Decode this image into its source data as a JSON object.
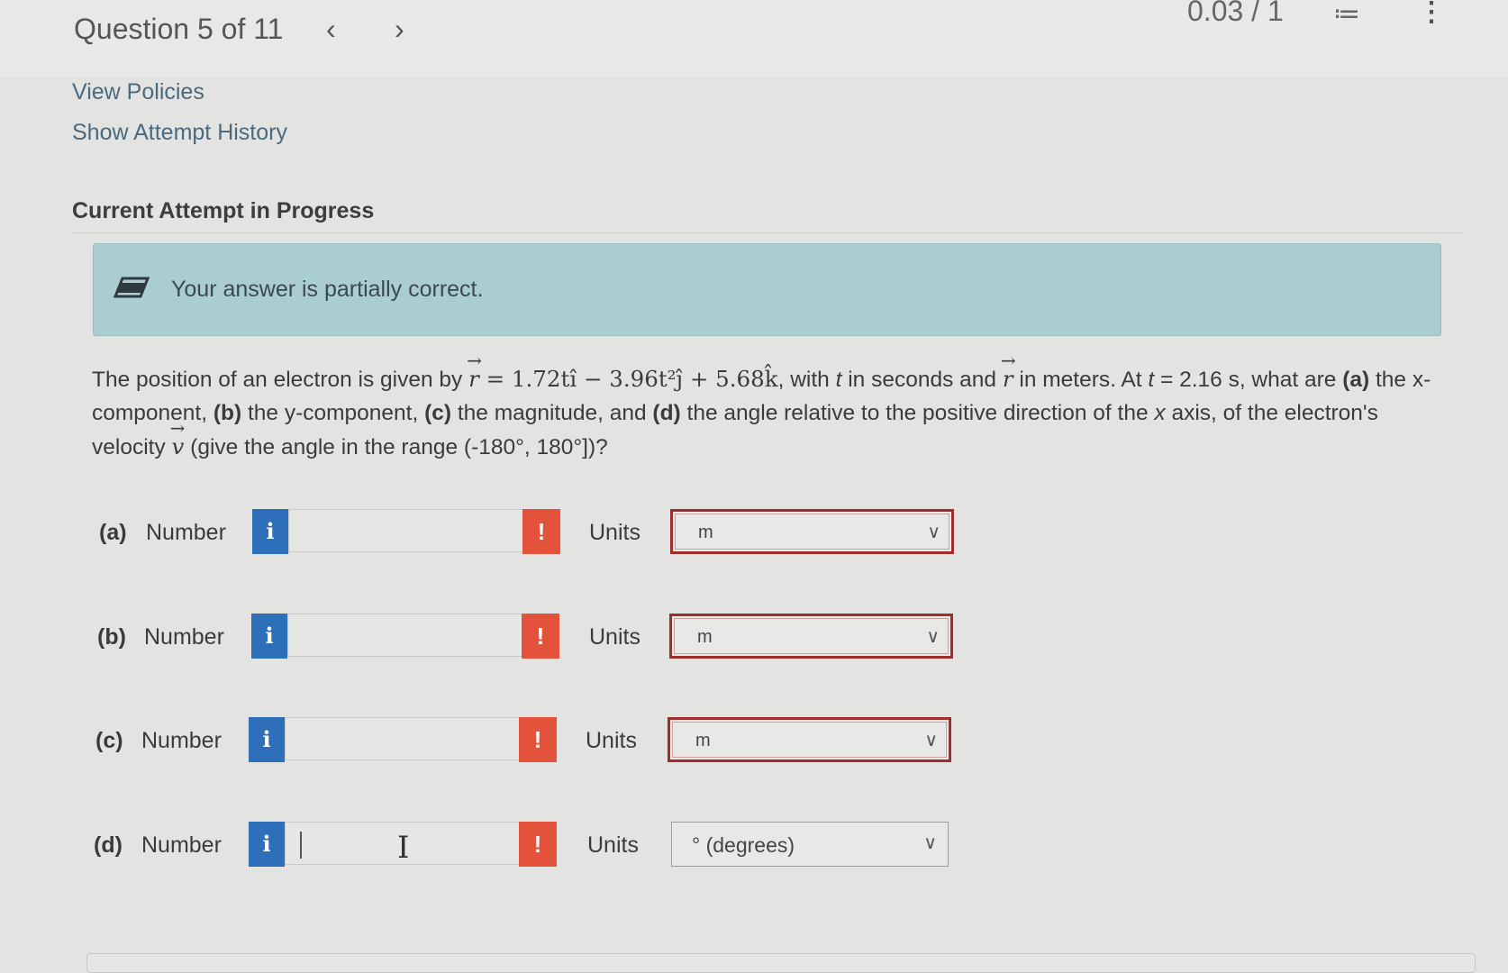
{
  "header": {
    "question_label": "Question 5 of 11",
    "prev_icon": "chevron-left-icon",
    "next_icon": "chevron-right-icon",
    "score": "0.03 / 1",
    "list_icon": "list-icon",
    "more_icon": "more-vertical-icon"
  },
  "links": {
    "view_policies": "View Policies",
    "show_attempt_history": "Show Attempt History"
  },
  "attempt": {
    "title": "Current Attempt in Progress"
  },
  "banner": {
    "icon": "eraser-icon",
    "text": "Your answer is partially correct.",
    "color": "#a9cdd1"
  },
  "question": {
    "intro": "The position of an electron is given by ",
    "equation_r": "r",
    "equation_rest": " = 1.72tî − 3.96t²ĵ + 5.68k̂",
    "mid1": ", with ",
    "t_var": "t",
    "mid2": " in seconds and ",
    "r_var": "r",
    "mid3": " in meters. At ",
    "t_var2": "t",
    "mid4": " = 2.16 s, what are ",
    "a_label": "(a)",
    "a_text": " the x-component, ",
    "b_label": "(b)",
    "b_text": " the y-component, ",
    "c_label": "(c)",
    "c_text": " the magnitude, and ",
    "d_label": "(d)",
    "d_text1": " the angle relative to the positive direction of the ",
    "x_var": "x",
    "d_text2": " axis, of the electron's velocity ",
    "v_var": "v",
    "tail": " (give the angle in the range (-180°, 180°])?"
  },
  "parts": [
    {
      "label": "(a)",
      "number_label": "Number",
      "value": "",
      "units_label": "Units",
      "unit": "m",
      "status": "incorrect"
    },
    {
      "label": "(b)",
      "number_label": "Number",
      "value": "",
      "units_label": "Units",
      "unit": "m",
      "status": "incorrect"
    },
    {
      "label": "(c)",
      "number_label": "Number",
      "value": "",
      "units_label": "Units",
      "unit": "m",
      "status": "incorrect"
    },
    {
      "label": "(d)",
      "number_label": "Number",
      "value": "",
      "units_label": "Units",
      "unit": "° (degrees)",
      "status": "neutral"
    }
  ],
  "buttons": {
    "info_glyph": "i",
    "warn_glyph": "!"
  },
  "colors": {
    "info": "#2d6fb9",
    "warning": "#e3533b",
    "incorrect_border": "#9e2d2d"
  }
}
